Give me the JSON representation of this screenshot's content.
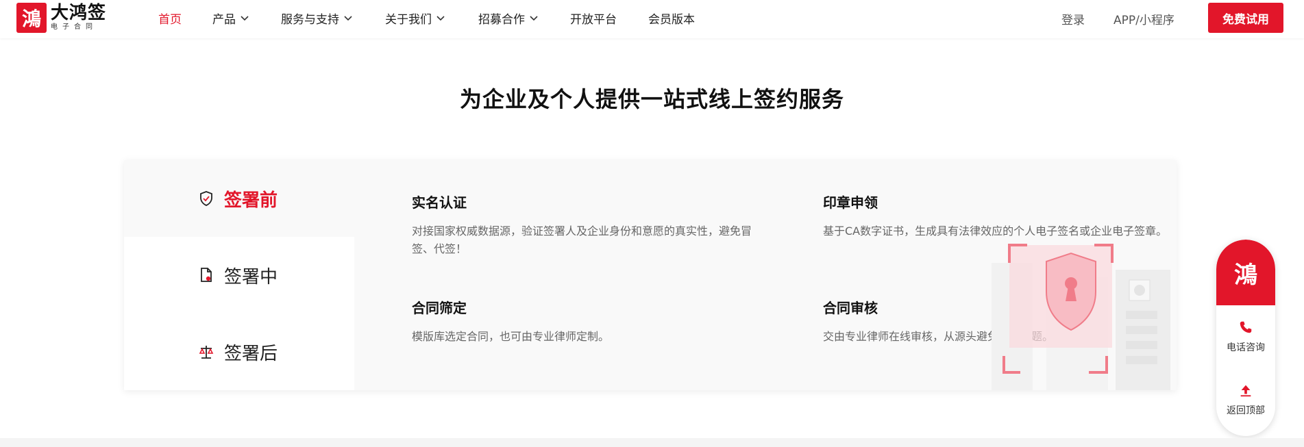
{
  "brand": {
    "mark": "鴻",
    "name": "大鸿签",
    "sub": "电子合同"
  },
  "nav": [
    {
      "label": "首页",
      "active": true,
      "dropdown": false
    },
    {
      "label": "产品",
      "active": false,
      "dropdown": true
    },
    {
      "label": "服务与支持",
      "active": false,
      "dropdown": true
    },
    {
      "label": "关于我们",
      "active": false,
      "dropdown": true
    },
    {
      "label": "招募合作",
      "active": false,
      "dropdown": true
    },
    {
      "label": "开放平台",
      "active": false,
      "dropdown": false
    },
    {
      "label": "会员版本",
      "active": false,
      "dropdown": false
    }
  ],
  "header_right": {
    "login": "登录",
    "app": "APP/小程序",
    "trial": "免费试用"
  },
  "section": {
    "title": "为企业及个人提供一站式线上签约服务"
  },
  "tabs": [
    {
      "label": "签署前",
      "icon": "shield-check-icon",
      "active": true
    },
    {
      "label": "签署中",
      "icon": "document-seal-icon",
      "active": false
    },
    {
      "label": "签署后",
      "icon": "balance-scale-icon",
      "active": false
    }
  ],
  "features": [
    {
      "title": "实名认证",
      "desc": "对接国家权威数据源，验证签署人及企业身份和意愿的真实性，避免冒签、代签！"
    },
    {
      "title": "印章申领",
      "desc": "基于CA数字证书，生成具有法律效应的个人电子签名或企业电子签章。"
    },
    {
      "title": "合同筛定",
      "desc": "模版库选定合同，也可由专业律师定制。"
    },
    {
      "title": "合同审核",
      "desc": "交由专业律师在线审核，从源头避免法律问题。"
    }
  ],
  "float": {
    "mark": "鴻",
    "phone": "电话咨询",
    "top": "返回顶部"
  },
  "colors": {
    "accent": "#e2162a",
    "text": "#222222",
    "muted": "#666666",
    "panel_bg": "#f9f9f9"
  }
}
